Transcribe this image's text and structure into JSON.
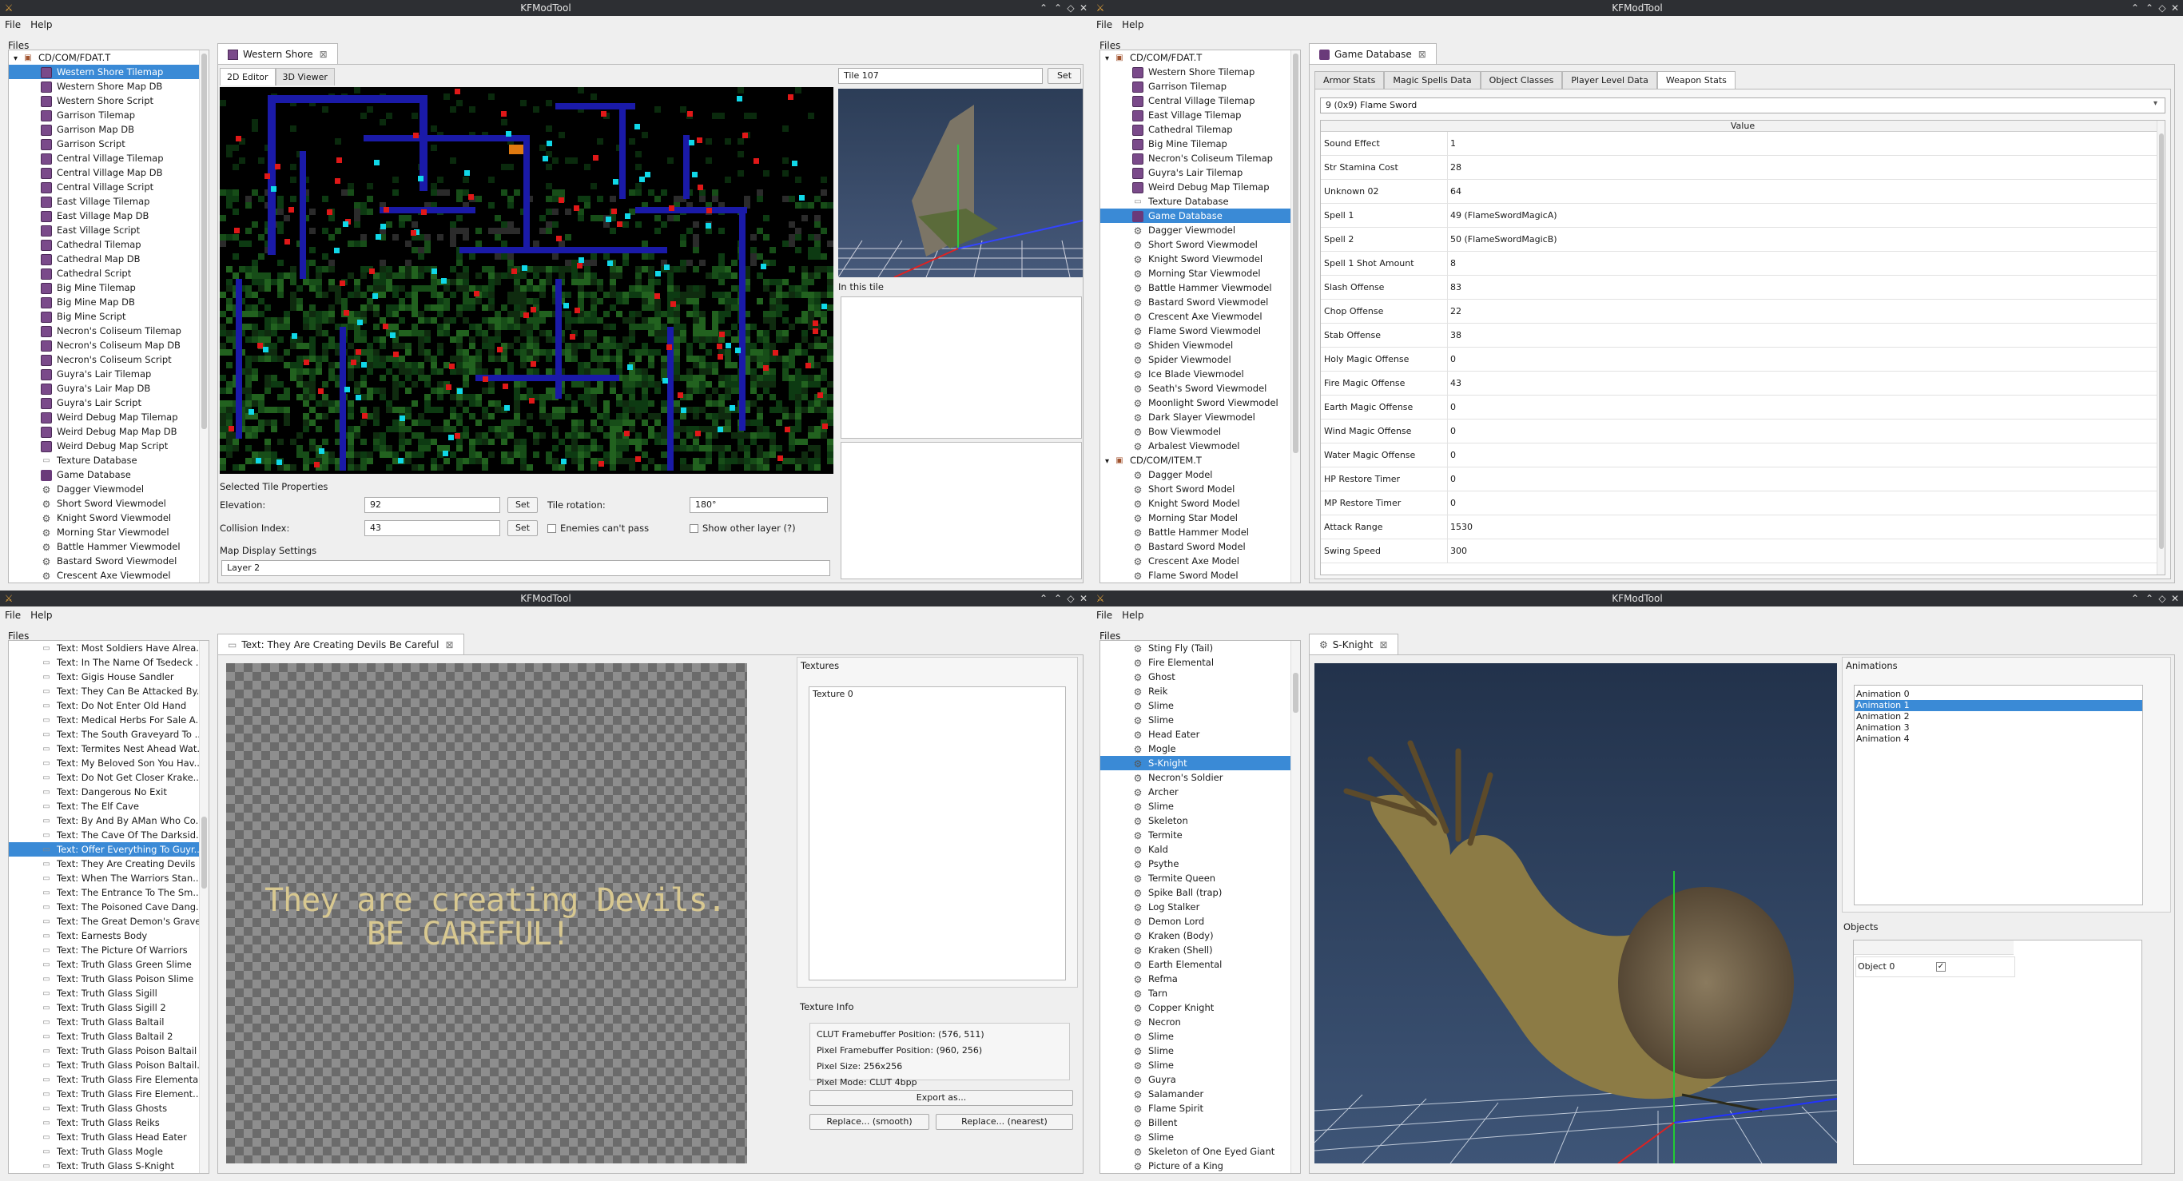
{
  "app_title": "KFModTool",
  "menu": {
    "file": "File",
    "help": "Help"
  },
  "files_label": "Files",
  "win1": {
    "tree": [
      {
        "label": "CD/COM/FDAT.T",
        "icon": "folder",
        "level": 0,
        "toggle": "▾"
      },
      {
        "label": "Western Shore Tilemap",
        "icon": "tile",
        "level": 1,
        "selected": true
      },
      {
        "label": "Western Shore Map DB",
        "icon": "tile",
        "level": 1
      },
      {
        "label": "Western Shore Script",
        "icon": "tile",
        "level": 1
      },
      {
        "label": "Garrison Tilemap",
        "icon": "tile",
        "level": 1
      },
      {
        "label": "Garrison Map DB",
        "icon": "tile",
        "level": 1
      },
      {
        "label": "Garrison Script",
        "icon": "tile",
        "level": 1
      },
      {
        "label": "Central Village Tilemap",
        "icon": "tile",
        "level": 1
      },
      {
        "label": "Central Village Map DB",
        "icon": "tile",
        "level": 1
      },
      {
        "label": "Central Village Script",
        "icon": "tile",
        "level": 1
      },
      {
        "label": "East Village Tilemap",
        "icon": "tile",
        "level": 1
      },
      {
        "label": "East Village Map DB",
        "icon": "tile",
        "level": 1
      },
      {
        "label": "East Village Script",
        "icon": "tile",
        "level": 1
      },
      {
        "label": "Cathedral Tilemap",
        "icon": "tile",
        "level": 1
      },
      {
        "label": "Cathedral Map DB",
        "icon": "tile",
        "level": 1
      },
      {
        "label": "Cathedral Script",
        "icon": "tile",
        "level": 1
      },
      {
        "label": "Big Mine Tilemap",
        "icon": "tile",
        "level": 1
      },
      {
        "label": "Big Mine Map DB",
        "icon": "tile",
        "level": 1
      },
      {
        "label": "Big Mine Script",
        "icon": "tile",
        "level": 1
      },
      {
        "label": "Necron's Coliseum Tilemap",
        "icon": "tile",
        "level": 1
      },
      {
        "label": "Necron's Coliseum Map DB",
        "icon": "tile",
        "level": 1
      },
      {
        "label": "Necron's Coliseum Script",
        "icon": "tile",
        "level": 1
      },
      {
        "label": "Guyra's Lair Tilemap",
        "icon": "tile",
        "level": 1
      },
      {
        "label": "Guyra's Lair Map DB",
        "icon": "tile",
        "level": 1
      },
      {
        "label": "Guyra's Lair Script",
        "icon": "tile",
        "level": 1
      },
      {
        "label": "Weird Debug Map Tilemap",
        "icon": "tile",
        "level": 1
      },
      {
        "label": "Weird Debug Map Map DB",
        "icon": "tile",
        "level": 1
      },
      {
        "label": "Weird Debug Map Script",
        "icon": "tile",
        "level": 1
      },
      {
        "label": "Texture Database",
        "icon": "txt",
        "level": 1
      },
      {
        "label": "Game Database",
        "icon": "db",
        "level": 1
      },
      {
        "label": "Dagger Viewmodel",
        "icon": "gear",
        "level": 1
      },
      {
        "label": "Short Sword Viewmodel",
        "icon": "gear",
        "level": 1
      },
      {
        "label": "Knight Sword Viewmodel",
        "icon": "gear",
        "level": 1
      },
      {
        "label": "Morning Star Viewmodel",
        "icon": "gear",
        "level": 1
      },
      {
        "label": "Battle Hammer Viewmodel",
        "icon": "gear",
        "level": 1
      },
      {
        "label": "Bastard Sword Viewmodel",
        "icon": "gear",
        "level": 1
      },
      {
        "label": "Crescent Axe Viewmodel",
        "icon": "gear",
        "level": 1
      }
    ],
    "doc_tab": "Western Shore",
    "subtab_2d": "2D Editor",
    "subtab_3d": "3D Viewer",
    "tile_select": "Tile 107",
    "set": "Set",
    "in_this_tile": "In this tile",
    "selected_tile_props": "Selected Tile Properties",
    "elevation_label": "Elevation:",
    "elevation_value": "92",
    "collision_label": "Collision Index:",
    "collision_value": "43",
    "rotation_label": "Tile rotation:",
    "rotation_value": "180°",
    "enemies_cant_pass": "Enemies can't pass",
    "show_other_layer": "Show other layer (?)",
    "map_display_settings": "Map Display Settings",
    "layer_value": "Layer 2"
  },
  "win2": {
    "tree": [
      {
        "label": "CD/COM/FDAT.T",
        "icon": "folder",
        "level": 0,
        "toggle": "▾"
      },
      {
        "label": "Western Shore Tilemap",
        "icon": "tile",
        "level": 1
      },
      {
        "label": "Garrison Tilemap",
        "icon": "tile",
        "level": 1
      },
      {
        "label": "Central Village Tilemap",
        "icon": "tile",
        "level": 1
      },
      {
        "label": "East Village Tilemap",
        "icon": "tile",
        "level": 1
      },
      {
        "label": "Cathedral Tilemap",
        "icon": "tile",
        "level": 1
      },
      {
        "label": "Big Mine Tilemap",
        "icon": "tile",
        "level": 1
      },
      {
        "label": "Necron's Coliseum Tilemap",
        "icon": "tile",
        "level": 1
      },
      {
        "label": "Guyra's Lair Tilemap",
        "icon": "tile",
        "level": 1
      },
      {
        "label": "Weird Debug Map Tilemap",
        "icon": "tile",
        "level": 1
      },
      {
        "label": "Texture Database",
        "icon": "txt",
        "level": 1
      },
      {
        "label": "Game Database",
        "icon": "db",
        "level": 1,
        "selected": true
      },
      {
        "label": "Dagger Viewmodel",
        "icon": "gear",
        "level": 1
      },
      {
        "label": "Short Sword Viewmodel",
        "icon": "gear",
        "level": 1
      },
      {
        "label": "Knight Sword Viewmodel",
        "icon": "gear",
        "level": 1
      },
      {
        "label": "Morning Star Viewmodel",
        "icon": "gear",
        "level": 1
      },
      {
        "label": "Battle Hammer Viewmodel",
        "icon": "gear",
        "level": 1
      },
      {
        "label": "Bastard Sword Viewmodel",
        "icon": "gear",
        "level": 1
      },
      {
        "label": "Crescent Axe Viewmodel",
        "icon": "gear",
        "level": 1
      },
      {
        "label": "Flame Sword Viewmodel",
        "icon": "gear",
        "level": 1
      },
      {
        "label": "Shiden Viewmodel",
        "icon": "gear",
        "level": 1
      },
      {
        "label": "Spider Viewmodel",
        "icon": "gear",
        "level": 1
      },
      {
        "label": "Ice Blade Viewmodel",
        "icon": "gear",
        "level": 1
      },
      {
        "label": "Seath's Sword Viewmodel",
        "icon": "gear",
        "level": 1
      },
      {
        "label": "Moonlight Sword Viewmodel",
        "icon": "gear",
        "level": 1
      },
      {
        "label": "Dark Slayer Viewmodel",
        "icon": "gear",
        "level": 1
      },
      {
        "label": "Bow Viewmodel",
        "icon": "gear",
        "level": 1
      },
      {
        "label": "Arbalest Viewmodel",
        "icon": "gear",
        "level": 1
      },
      {
        "label": "CD/COM/ITEM.T",
        "icon": "folder",
        "level": 0,
        "toggle": "▾"
      },
      {
        "label": "Dagger Model",
        "icon": "gear",
        "level": 1
      },
      {
        "label": "Short Sword Model",
        "icon": "gear",
        "level": 1
      },
      {
        "label": "Knight Sword Model",
        "icon": "gear",
        "level": 1
      },
      {
        "label": "Morning Star Model",
        "icon": "gear",
        "level": 1
      },
      {
        "label": "Battle Hammer Model",
        "icon": "gear",
        "level": 1
      },
      {
        "label": "Bastard Sword Model",
        "icon": "gear",
        "level": 1
      },
      {
        "label": "Crescent Axe Model",
        "icon": "gear",
        "level": 1
      },
      {
        "label": "Flame Sword Model",
        "icon": "gear",
        "level": 1
      }
    ],
    "doc_tab": "Game Database",
    "tabs": [
      "Armor Stats",
      "Magic Spells Data",
      "Object Classes",
      "Player Level Data",
      "Weapon Stats"
    ],
    "weapon_select": "9 (0x9) Flame Sword",
    "value_header": "Value",
    "rows": [
      {
        "k": "Sound Effect",
        "v": "1"
      },
      {
        "k": "Str Stamina Cost",
        "v": "28"
      },
      {
        "k": "Unknown 02",
        "v": "64"
      },
      {
        "k": "Spell 1",
        "v": "49 (FlameSwordMagicA)"
      },
      {
        "k": "Spell 2",
        "v": "50 (FlameSwordMagicB)"
      },
      {
        "k": "Spell 1 Shot Amount",
        "v": "8"
      },
      {
        "k": "Slash Offense",
        "v": "83"
      },
      {
        "k": "Chop Offense",
        "v": "22"
      },
      {
        "k": "Stab Offense",
        "v": "38"
      },
      {
        "k": "Holy Magic Offense",
        "v": "0"
      },
      {
        "k": "Fire Magic Offense",
        "v": "43"
      },
      {
        "k": "Earth Magic Offense",
        "v": "0"
      },
      {
        "k": "Wind Magic Offense",
        "v": "0"
      },
      {
        "k": "Water Magic Offense",
        "v": "0"
      },
      {
        "k": "HP Restore Timer",
        "v": "0"
      },
      {
        "k": "MP Restore Timer",
        "v": "0"
      },
      {
        "k": "Attack Range",
        "v": "1530"
      },
      {
        "k": "Swing Speed",
        "v": "300"
      }
    ]
  },
  "win3": {
    "tree": [
      {
        "label": "Text: Most Soldiers Have Alrea...",
        "icon": "txt",
        "level": 1
      },
      {
        "label": "Text: In The Name Of Tsedeck ...",
        "icon": "txt",
        "level": 1
      },
      {
        "label": "Text: Gigis House Sandler",
        "icon": "txt",
        "level": 1
      },
      {
        "label": "Text: They Can Be Attacked By...",
        "icon": "txt",
        "level": 1
      },
      {
        "label": "Text: Do Not Enter Old Hand",
        "icon": "txt",
        "level": 1
      },
      {
        "label": "Text: Medical Herbs For Sale A...",
        "icon": "txt",
        "level": 1
      },
      {
        "label": "Text: The South Graveyard To ...",
        "icon": "txt",
        "level": 1
      },
      {
        "label": "Text: Termites Nest Ahead Wat...",
        "icon": "txt",
        "level": 1
      },
      {
        "label": "Text: My Beloved Son You Hav...",
        "icon": "txt",
        "level": 1
      },
      {
        "label": "Text: Do Not Get Closer Krake...",
        "icon": "txt",
        "level": 1
      },
      {
        "label": "Text: Dangerous No Exit",
        "icon": "txt",
        "level": 1
      },
      {
        "label": "Text: The Elf Cave",
        "icon": "txt",
        "level": 1
      },
      {
        "label": "Text: By And By AMan Who Co...",
        "icon": "txt",
        "level": 1
      },
      {
        "label": "Text: The Cave Of The Darksid...",
        "icon": "txt",
        "level": 1
      },
      {
        "label": "Text: Offer Everything To Guyr...",
        "icon": "txt",
        "level": 1,
        "selected": true
      },
      {
        "label": "Text: They Are Creating Devils ...",
        "icon": "txt",
        "level": 1
      },
      {
        "label": "Text: When The Warriors Stan...",
        "icon": "txt",
        "level": 1
      },
      {
        "label": "Text: The Entrance To The Sm...",
        "icon": "txt",
        "level": 1
      },
      {
        "label": "Text: The Poisoned Cave Dang...",
        "icon": "txt",
        "level": 1
      },
      {
        "label": "Text: The Great Demon's Grave",
        "icon": "txt",
        "level": 1
      },
      {
        "label": "Text: Earnests Body",
        "icon": "txt",
        "level": 1
      },
      {
        "label": "Text: The Picture Of Warriors",
        "icon": "txt",
        "level": 1
      },
      {
        "label": "Text: Truth Glass Green Slime",
        "icon": "txt",
        "level": 1
      },
      {
        "label": "Text: Truth Glass Poison Slime",
        "icon": "txt",
        "level": 1
      },
      {
        "label": "Text: Truth Glass Sigill",
        "icon": "txt",
        "level": 1
      },
      {
        "label": "Text: Truth Glass Sigill 2",
        "icon": "txt",
        "level": 1
      },
      {
        "label": "Text: Truth Glass Baltail",
        "icon": "txt",
        "level": 1
      },
      {
        "label": "Text: Truth Glass Baltail 2",
        "icon": "txt",
        "level": 1
      },
      {
        "label": "Text: Truth Glass Poison Baltail",
        "icon": "txt",
        "level": 1
      },
      {
        "label": "Text: Truth Glass Poison Baltail...",
        "icon": "txt",
        "level": 1
      },
      {
        "label": "Text: Truth Glass Fire Elemental",
        "icon": "txt",
        "level": 1
      },
      {
        "label": "Text: Truth Glass Fire Element...",
        "icon": "txt",
        "level": 1
      },
      {
        "label": "Text: Truth Glass Ghosts",
        "icon": "txt",
        "level": 1
      },
      {
        "label": "Text: Truth Glass Reiks",
        "icon": "txt",
        "level": 1
      },
      {
        "label": "Text: Truth Glass Head Eater",
        "icon": "txt",
        "level": 1
      },
      {
        "label": "Text: Truth Glass Mogle",
        "icon": "txt",
        "level": 1
      },
      {
        "label": "Text: Truth Glass S-Knight",
        "icon": "txt",
        "level": 1
      }
    ],
    "doc_tab": "Text: They Are Creating Devils Be Careful",
    "preview_line1": "They are creating Devils.",
    "preview_line2": "BE CAREFUL!",
    "textures_label": "Textures",
    "texture_item": "Texture 0",
    "texture_info_label": "Texture Info",
    "clut_pos": "CLUT Framebuffer Position: (576, 511)",
    "pixel_pos": "Pixel Framebuffer Position: (960, 256)",
    "pixel_size": "Pixel Size: 256x256",
    "pixel_mode": "Pixel Mode: CLUT 4bpp",
    "export_btn": "Export as...",
    "replace_smooth": "Replace... (smooth)",
    "replace_nearest": "Replace... (nearest)"
  },
  "win4": {
    "tree": [
      {
        "label": "Sting Fly (Tail)",
        "icon": "gear",
        "level": 1
      },
      {
        "label": "Fire Elemental",
        "icon": "gear",
        "level": 1
      },
      {
        "label": "Ghost",
        "icon": "gear",
        "level": 1
      },
      {
        "label": "Reik",
        "icon": "gear",
        "level": 1
      },
      {
        "label": "Slime",
        "icon": "gear",
        "level": 1
      },
      {
        "label": "Slime",
        "icon": "gear",
        "level": 1
      },
      {
        "label": "Head Eater",
        "icon": "gear",
        "level": 1
      },
      {
        "label": "Mogle",
        "icon": "gear",
        "level": 1
      },
      {
        "label": "S-Knight",
        "icon": "gear",
        "level": 1,
        "selected": true
      },
      {
        "label": "Necron's Soldier",
        "icon": "gear",
        "level": 1
      },
      {
        "label": "Archer",
        "icon": "gear",
        "level": 1
      },
      {
        "label": "Slime",
        "icon": "gear",
        "level": 1
      },
      {
        "label": "Skeleton",
        "icon": "gear",
        "level": 1
      },
      {
        "label": "Termite",
        "icon": "gear",
        "level": 1
      },
      {
        "label": "Kald",
        "icon": "gear",
        "level": 1
      },
      {
        "label": "Psythe",
        "icon": "gear",
        "level": 1
      },
      {
        "label": "Termite Queen",
        "icon": "gear",
        "level": 1
      },
      {
        "label": "Spike Ball (trap)",
        "icon": "gear",
        "level": 1
      },
      {
        "label": "Log Stalker",
        "icon": "gear",
        "level": 1
      },
      {
        "label": "Demon Lord",
        "icon": "gear",
        "level": 1
      },
      {
        "label": "Kraken (Body)",
        "icon": "gear",
        "level": 1
      },
      {
        "label": "Kraken (Shell)",
        "icon": "gear",
        "level": 1
      },
      {
        "label": "Earth Elemental",
        "icon": "gear",
        "level": 1
      },
      {
        "label": "Refma",
        "icon": "gear",
        "level": 1
      },
      {
        "label": "Tarn",
        "icon": "gear",
        "level": 1
      },
      {
        "label": "Copper Knight",
        "icon": "gear",
        "level": 1
      },
      {
        "label": "Necron",
        "icon": "gear",
        "level": 1
      },
      {
        "label": "Slime",
        "icon": "gear",
        "level": 1
      },
      {
        "label": "Slime",
        "icon": "gear",
        "level": 1
      },
      {
        "label": "Slime",
        "icon": "gear",
        "level": 1
      },
      {
        "label": "Guyra",
        "icon": "gear",
        "level": 1
      },
      {
        "label": "Salamander",
        "icon": "gear",
        "level": 1
      },
      {
        "label": "Flame Spirit",
        "icon": "gear",
        "level": 1
      },
      {
        "label": "Billent",
        "icon": "gear",
        "level": 1
      },
      {
        "label": "Slime",
        "icon": "gear",
        "level": 1
      },
      {
        "label": "Skeleton of One Eyed Giant",
        "icon": "gear",
        "level": 1
      },
      {
        "label": "Picture of a King",
        "icon": "gear",
        "level": 1
      }
    ],
    "doc_tab": "S-Knight",
    "animations_label": "Animations",
    "animations": [
      "Animation 0",
      "Animation 1",
      "Animation 2",
      "Animation 3",
      "Animation 4"
    ],
    "selected_animation": 1,
    "objects_label": "Objects",
    "object_item": "Object 0",
    "object_check": "✓"
  }
}
